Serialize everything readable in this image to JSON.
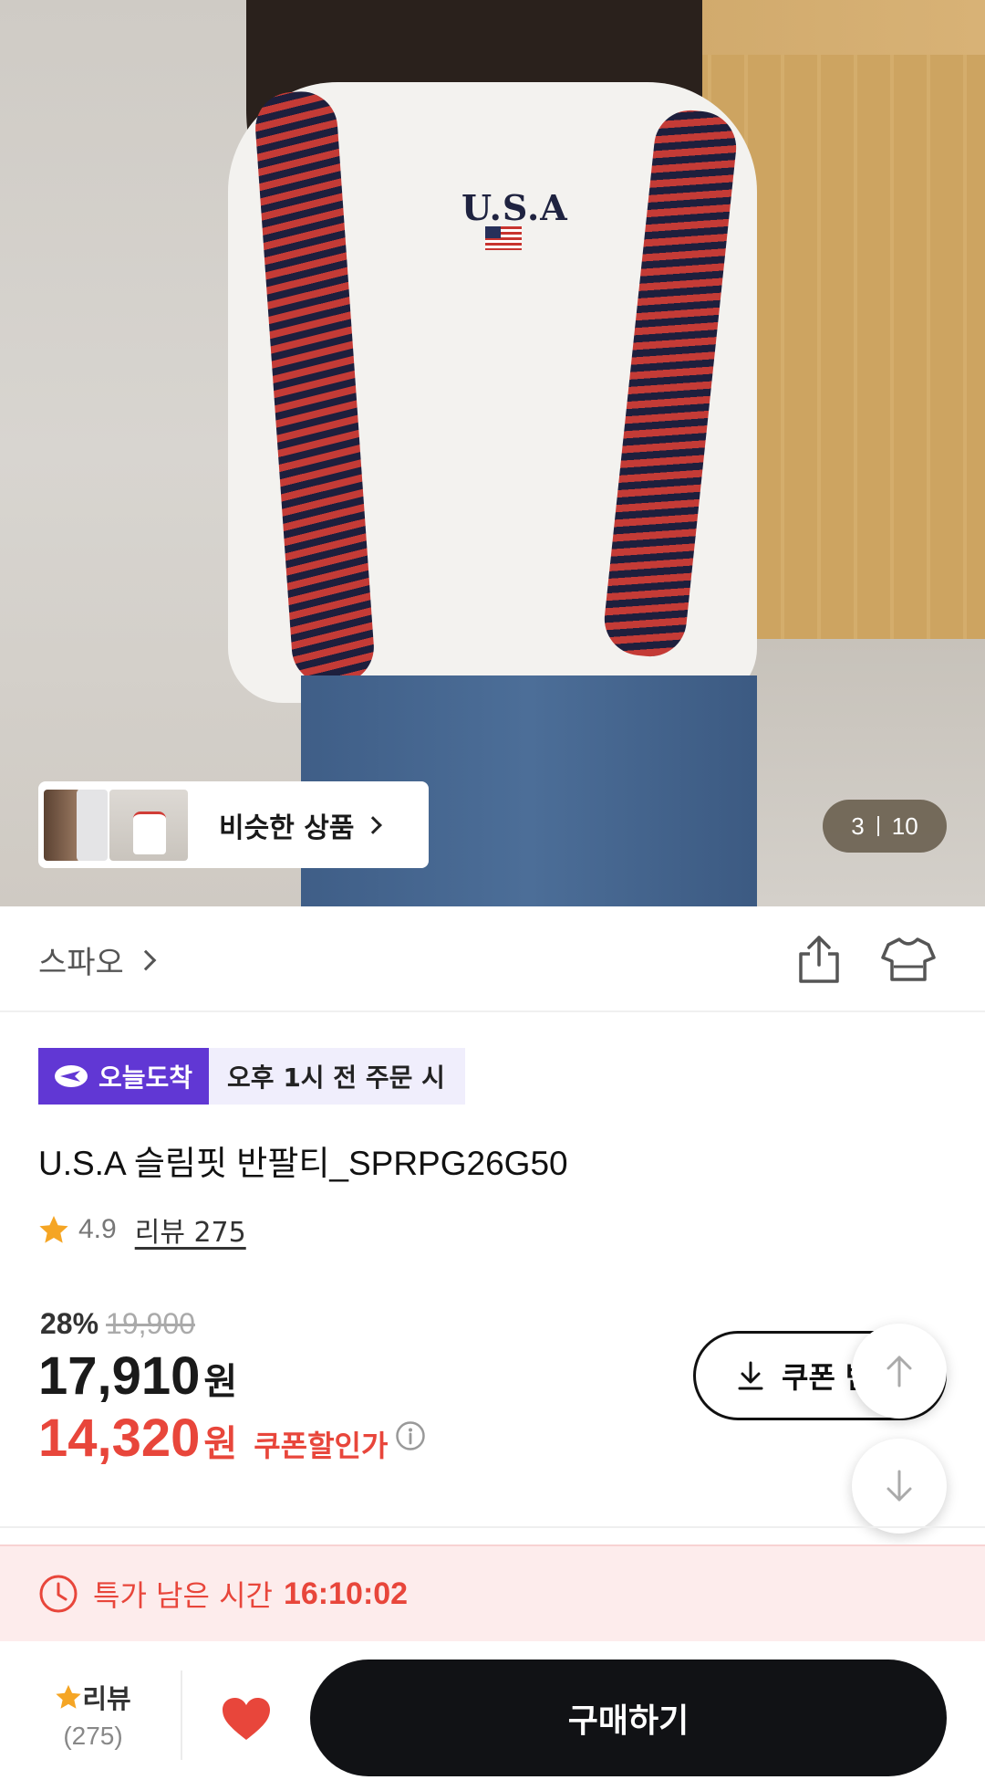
{
  "gallery": {
    "shirt_print": "U.S.A",
    "similar_label": "비슷한 상품",
    "counter_current": "3",
    "counter_total": "10"
  },
  "brand": {
    "name": "스파오"
  },
  "delivery": {
    "badge_label": "오늘도착",
    "condition": "오후 1시 전 주문 시",
    "badge_color": "#6137d4"
  },
  "product": {
    "title": "U.S.A 슬림핏 반팔티_SPRPG26G50",
    "rating": "4.9",
    "review_link": "리뷰 275"
  },
  "price": {
    "discount_rate": "28%",
    "original": "19,900",
    "sale": "17,910",
    "sale_unit": "원",
    "coupon_price": "14,320",
    "coupon_unit": "원",
    "coupon_label": "쿠폰할인가",
    "accent_color": "#e8463b"
  },
  "coupon_button": {
    "label": "쿠폰 받기"
  },
  "timer": {
    "label": "특가 남은 시간",
    "remaining": "16:10:02"
  },
  "bottom_bar": {
    "review_label": "리뷰",
    "review_count": "(275)",
    "buy_label": "구매하기"
  }
}
